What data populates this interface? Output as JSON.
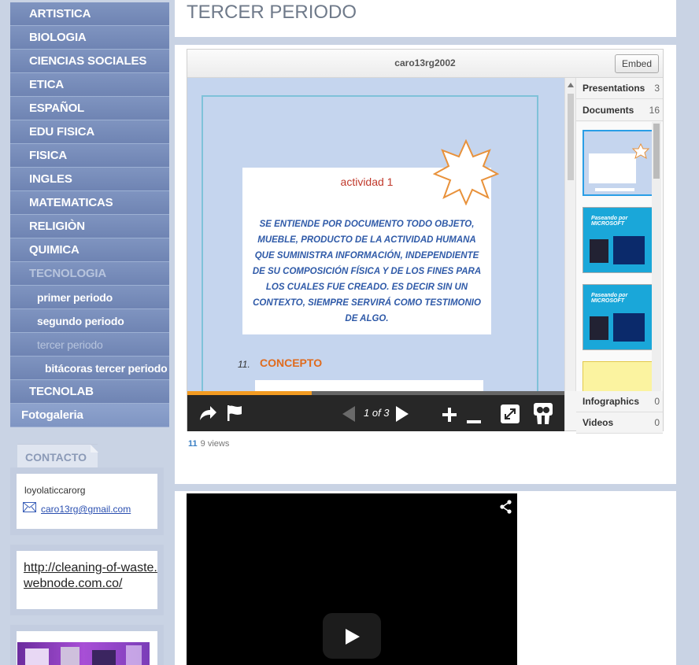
{
  "sidebar": {
    "menu": [
      {
        "label": "ARTISTICA"
      },
      {
        "label": "BIOLOGIA"
      },
      {
        "label": "CIENCIAS SOCIALES"
      },
      {
        "label": "ETICA"
      },
      {
        "label": "ESPAÑOL"
      },
      {
        "label": "EDU FISICA"
      },
      {
        "label": "FISICA"
      },
      {
        "label": "INGLES"
      },
      {
        "label": "MATEMATICAS"
      },
      {
        "label": "RELIGIÒN"
      },
      {
        "label": "QUIMICA"
      },
      {
        "label": "TECNOLOGIA"
      },
      {
        "label": "primer periodo"
      },
      {
        "label": "segundo periodo"
      },
      {
        "label": "tercer periodo"
      },
      {
        "label": "bitácoras tercer periodo"
      },
      {
        "label": "TECNOLAB"
      },
      {
        "label": "Fotogaleria"
      }
    ],
    "contacto_tab": "CONTACTO",
    "contact_name": "loyolaticcarorg",
    "contact_email": "caro13rg@gmail.com",
    "link_url": "http://cleaning-of-waste.webnode.com.co/"
  },
  "main": {
    "page_title": "TERCER PERIODO",
    "player": {
      "title": "caro13rg2002",
      "embed_label": "Embed",
      "slide": {
        "activity_title": "actividad 1",
        "body": "SE ENTIENDE POR DOCUMENTO TODO OBJETO, MUEBLE, PRODUCTO DE LA ACTIVIDAD HUMANA QUE SUMINISTRA INFORMACIÓN, INDEPENDIENTE DE SU COMPOSICIÓN FÍSICA Y DE LOS FINES PARA LOS CUALES FUE CREADO. ES DECIR SIN UN CONTEXTO, SIEMPRE SERVIRÁ COMO TESTIMONIO DE ALGO.",
        "section_number": "11.",
        "section_title": "CONCEPTO"
      },
      "page_count": "1 of 3",
      "progress": 0.33,
      "side": {
        "presentations_label": "Presentations",
        "presentations_count": "3",
        "documents_label": "Documents",
        "documents_count": "16",
        "thumb_caption": "Paseando por MICROSOFT",
        "infographics_label": "Infographics",
        "infographics_count": "0",
        "videos_label": "Videos",
        "videos_count": "0"
      }
    },
    "views_count": "11",
    "views_label": "9 views"
  },
  "colors": {
    "sidebar_item": "#7488b8",
    "accent_orange": "#f29b22",
    "page_bg": "#c9d3e4"
  }
}
